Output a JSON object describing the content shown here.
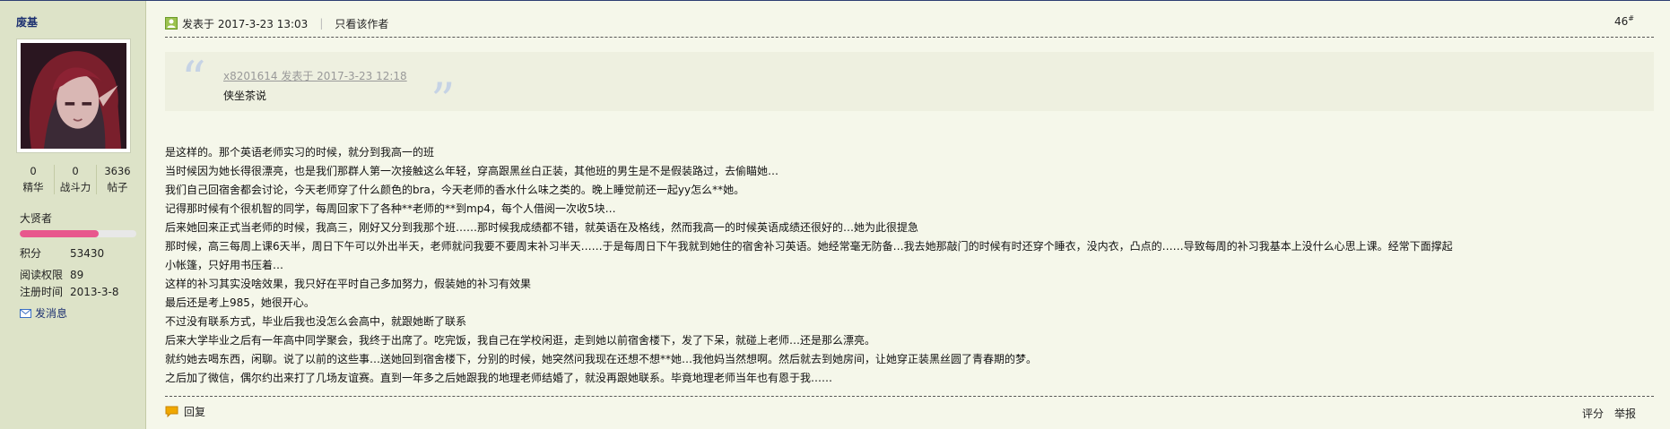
{
  "user": {
    "name": "废基",
    "stats": [
      {
        "value": "0",
        "label": "精华"
      },
      {
        "value": "0",
        "label": "战斗力"
      },
      {
        "value": "3636",
        "label": "帖子"
      }
    ],
    "rank_title": "大贤者",
    "rank_progress": 0.68,
    "info": [
      {
        "key": "积分",
        "value": "53430"
      },
      {
        "key": "阅读权限",
        "value": "89"
      },
      {
        "key": "注册时间",
        "value": "2013-3-8"
      }
    ],
    "pm_label": "发消息"
  },
  "post": {
    "posted_at": "发表于 2017-3-23 13:03",
    "only_author": "只看该作者",
    "floor_number": "46",
    "floor_suffix": "#",
    "quote": {
      "author": "x8201614 发表于 2017-3-23 12:18",
      "text": "侠坐茶说"
    },
    "lines": [
      "是这样的。那个英语老师实习的时候，就分到我高一的班",
      "当时候因为她长得很漂亮，也是我们那群人第一次接触这么年轻，穿高跟黑丝白正装，其他班的男生是不是假装路过，去偷瞄她…",
      "我们自己回宿舍都会讨论，今天老师穿了什么颜色的bra，今天老师的香水什么味之类的。晚上睡觉前还一起yy怎么**她。",
      "记得那时候有个很机智的同学，每周回家下了各种**老师的**到mp4，每个人借阅一次收5块…",
      "后来她回来正式当老师的时候，我高三，刚好又分到我那个班……那时候我成绩都不错，就英语在及格线，然而我高一的时候英语成绩还很好的…她为此很提急",
      "那时候，高三每周上课6天半，周日下午可以外出半天，老师就问我要不要周末补习半天……于是每周日下午我就到她住的宿舍补习英语。她经常毫无防备…我去她那敲门的时候有时还穿个睡衣，没内衣，凸点的……导致每周的补习我基本上没什么心思上课。经常下面撑起",
      "小帐篷，只好用书压着…",
      "这样的补习其实没啥效果，我只好在平时自己多加努力，假装她的补习有效果",
      "最后还是考上985，她很开心。",
      "不过没有联系方式，毕业后我也没怎么会高中，就跟她断了联系",
      "后来大学毕业之后有一年高中同学聚会，我终于出席了。吃完饭，我自己在学校闲逛，走到她以前宿舍楼下，发了下呆，就碰上老师…还是那么漂亮。",
      "就约她去喝东西，闲聊。说了以前的这些事…送她回到宿舍楼下，分别的时候，她突然问我现在还想不想**她…我他妈当然想啊。然后就去到她房间，让她穿正装黑丝圆了青春期的梦。",
      "之后加了微信，偶尔约出来打了几场友谊赛。直到一年多之后她跟我的地理老师结婚了，就没再跟她联系。毕竟地理老师当年也有恩于我……"
    ],
    "reply_label": "回复",
    "rate_label": "评分",
    "report_label": "举报"
  },
  "icons": {
    "poster": "user-badge-icon",
    "pm": "envelope-icon",
    "reply": "speech-bubble-icon"
  },
  "colors": {
    "page_bg": "#f5f7ea",
    "sidebar_bg": "#dde3c8",
    "link": "#1c3070",
    "rank_bar": "#e8578d",
    "quote_mark": "#c6d3e5"
  }
}
